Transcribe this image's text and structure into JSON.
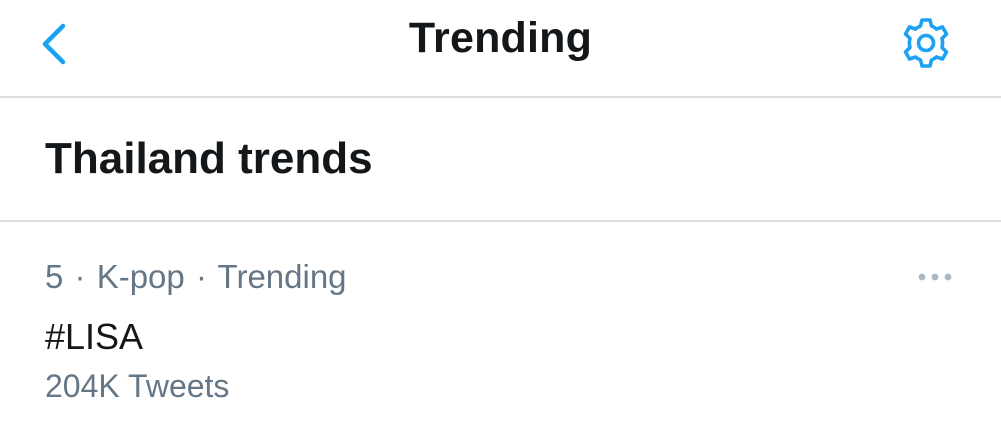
{
  "header": {
    "title": "Trending",
    "back_icon": "chevron-left-icon",
    "settings_icon": "gear-icon",
    "accent_color": "#1da1f2"
  },
  "section": {
    "title": "Thailand trends"
  },
  "trend": {
    "rank": "5",
    "category": "K-pop",
    "status": "Trending",
    "separator": "·",
    "name": "#LISA",
    "count": "204K Tweets",
    "more_icon": "more-horizontal-icon"
  },
  "colors": {
    "text_primary": "#14171a",
    "text_secondary": "#657786",
    "divider": "#d9dee2"
  }
}
